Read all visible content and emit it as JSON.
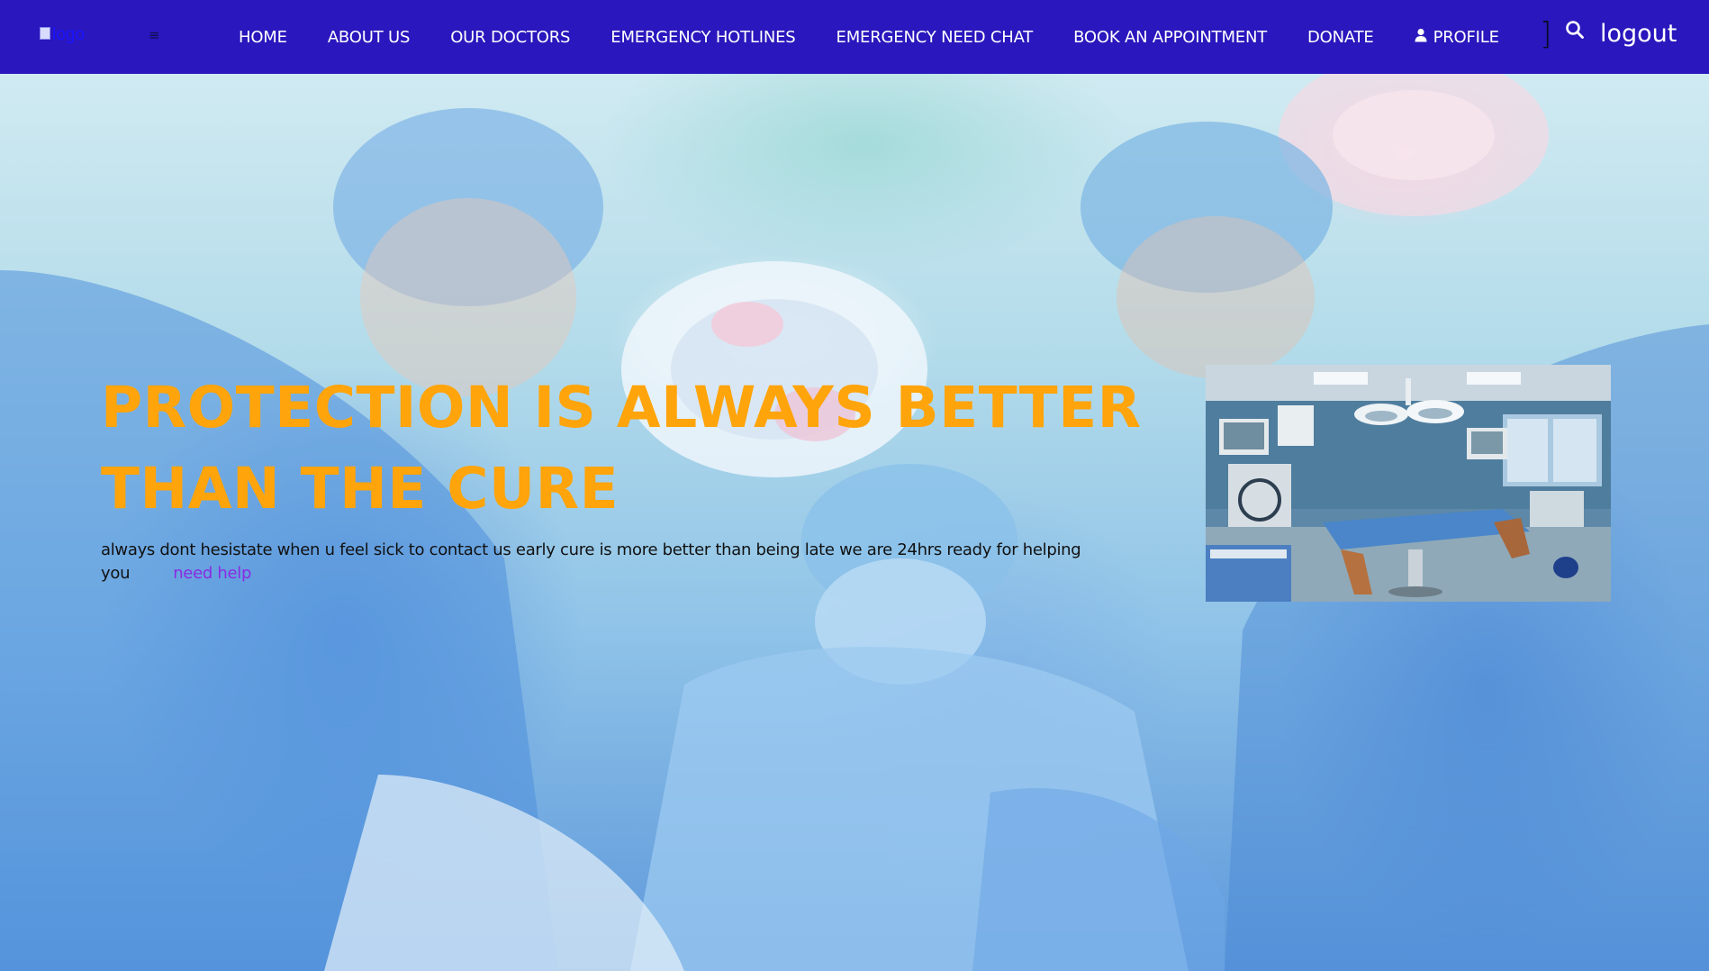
{
  "nav": {
    "logo_alt": "logo",
    "menu_icon": "≡",
    "links": [
      {
        "label": "HOME"
      },
      {
        "label": "ABOUT US"
      },
      {
        "label": "OUR DOCTORS"
      },
      {
        "label": "EMERGENCY HOTLINES"
      },
      {
        "label": "EMERGENCY NEED CHAT"
      },
      {
        "label": "BOOK AN APPOINTMENT"
      },
      {
        "label": "DONATE"
      },
      {
        "label": "PROFILE",
        "icon": "user-icon"
      }
    ],
    "bracket": "]",
    "search_icon": "search-icon",
    "logout_label": "logout"
  },
  "hero": {
    "headline": "PROTECTION IS ALWAYS BETTER THAN THE CURE",
    "tagline": "always dont hesistate when u feel sick to contact us early cure is more better than being late we are 24hrs ready for helping you",
    "help_link": "need help",
    "side_image": "operating-room-photo"
  },
  "colors": {
    "nav_bg": "#2a17bd",
    "headline": "#ffa40a",
    "link": "#8a2be2",
    "nav_text": "#ffffff"
  }
}
